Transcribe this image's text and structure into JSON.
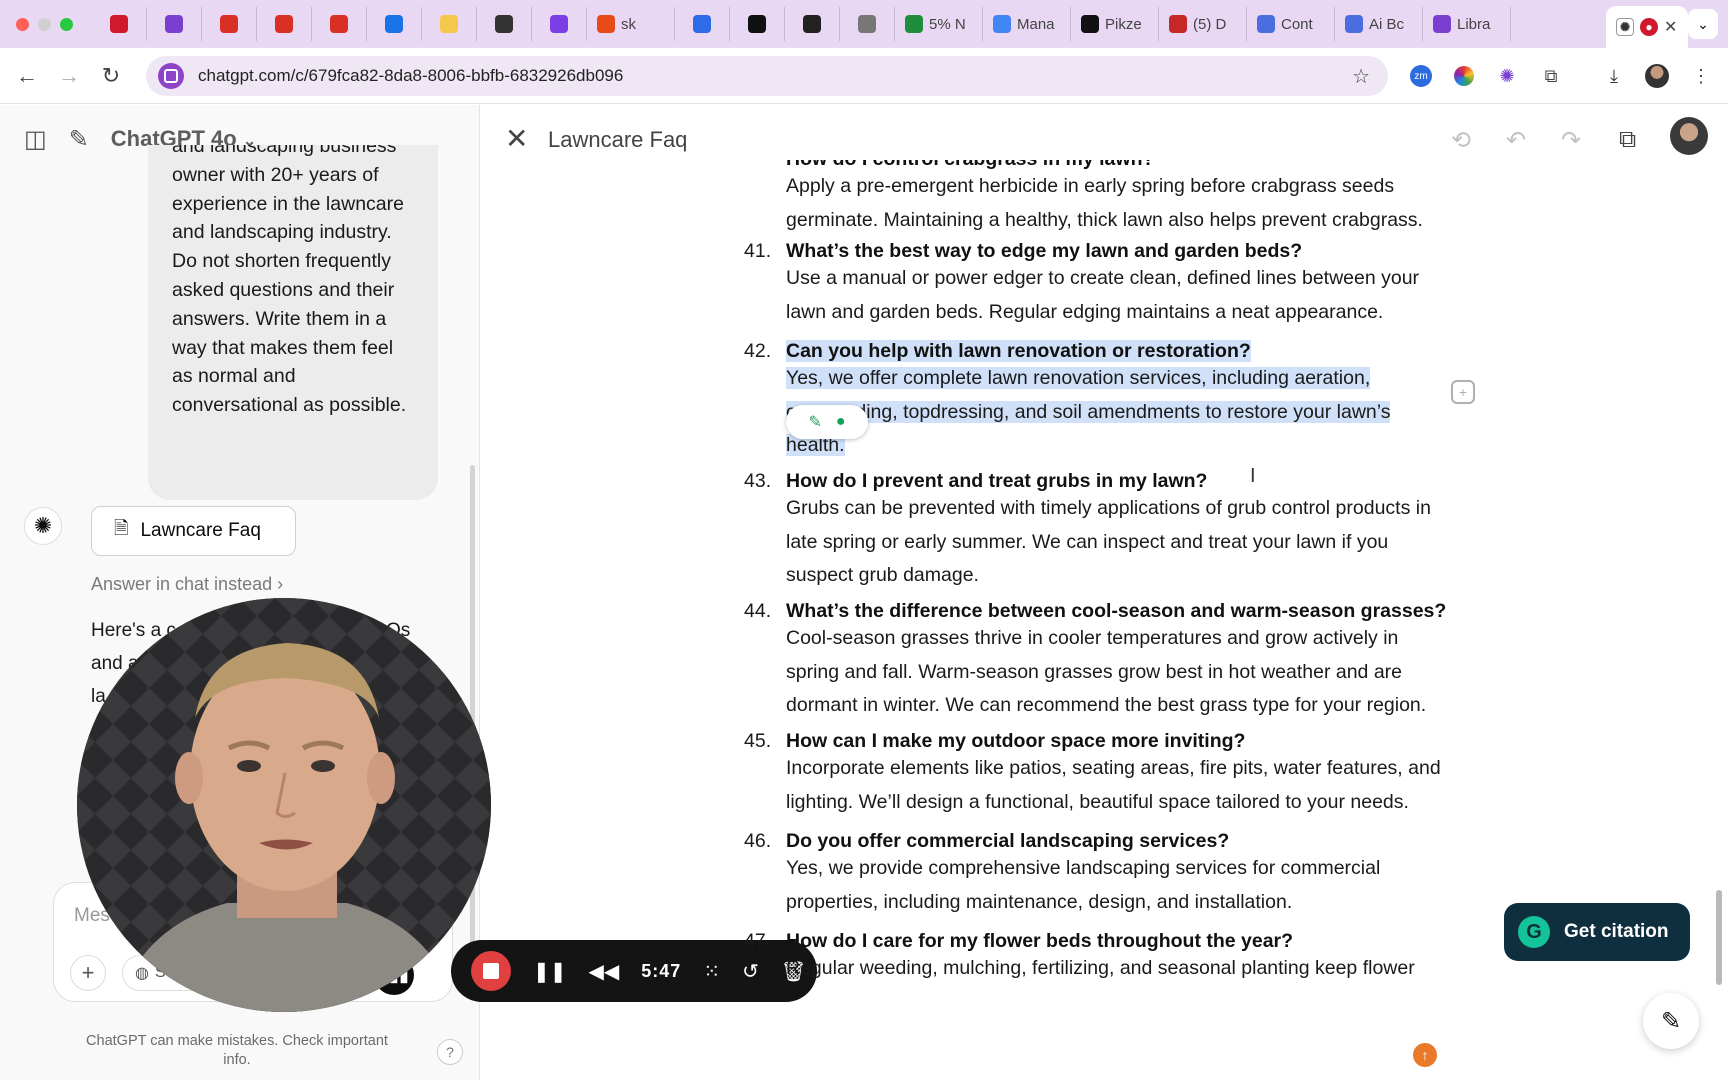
{
  "browser": {
    "tabs": [
      {
        "label": "",
        "icon": "recording-icon",
        "color": "#d0192c"
      },
      {
        "label": "",
        "icon": "asterisk-icon",
        "color": "#7a3fd1"
      },
      {
        "label": "",
        "icon": "gmail-icon",
        "color": "#d93025"
      },
      {
        "label": "",
        "icon": "gmail-icon",
        "color": "#d93025"
      },
      {
        "label": "",
        "icon": "gmail-icon",
        "color": "#d93025"
      },
      {
        "label": "",
        "icon": "calendar-icon",
        "color": "#1a73e8"
      },
      {
        "label": "",
        "icon": "trello-icon",
        "color": "#f2c94c"
      },
      {
        "label": "",
        "icon": "book-icon",
        "color": "#333333"
      },
      {
        "label": "",
        "icon": "s-app-icon",
        "color": "#7b3fe4"
      },
      {
        "label": "sk",
        "icon": "sk-icon",
        "color": "#e64a19"
      },
      {
        "label": "",
        "icon": "loop-icon",
        "color": "#2e6be6"
      },
      {
        "label": "",
        "icon": "s-square-icon",
        "color": "#111111"
      },
      {
        "label": "",
        "icon": "threads-icon",
        "color": "#222222"
      },
      {
        "label": "",
        "icon": "folder-icon",
        "color": "#777777"
      },
      {
        "label": "5% N",
        "icon": "sheets-icon",
        "color": "#1e8e3e"
      },
      {
        "label": "Mana",
        "icon": "google-icon",
        "color": "#4285f4"
      },
      {
        "label": "Pikze",
        "icon": "pikzels-icon",
        "color": "#111111"
      },
      {
        "label": "(5) D",
        "icon": "notification-icon",
        "color": "#c62828"
      },
      {
        "label": "Cont",
        "icon": "docs-icon",
        "color": "#4a6ee0"
      },
      {
        "label": "Ai Bc",
        "icon": "docs-icon",
        "color": "#4a6ee0"
      },
      {
        "label": "Libra",
        "icon": "asterisk-icon",
        "color": "#7a3fd1"
      }
    ],
    "active_tab_icon": "chatgpt-icon",
    "url": "chatgpt.com/c/679fca82-8da8-8006-bbfb-6832926db096"
  },
  "sidebar": {
    "model_name": "ChatGPT 4o",
    "user_message_lines": [
      "and landscaping business",
      "owner with 20+ years of",
      "experience in the lawncare",
      "and landscaping industry.",
      "Do not shorten frequently",
      "asked questions and their",
      "answers. Write them in a",
      "way that makes them feel",
      "as normal and",
      "conversational as possible."
    ],
    "canvas_card_label": "Lawncare Faq",
    "answer_link": "Answer in chat instead",
    "reply_partial_lines": [
      "Here's a c",
      "and a",
      "la"
    ],
    "reply_partial_right": "Os",
    "composer_placeholder": "Mes",
    "search_label": "Sea",
    "disclaimer": "ChatGPT can make mistakes. Check important info.",
    "help_label": "?"
  },
  "recorder": {
    "time": "5:47"
  },
  "document": {
    "title": "Lawncare Faq",
    "partial_top_question": "How do I control crabgrass in my lawn?",
    "partial_top_answer_lines": [
      "Apply a pre-emergent herbicide in early spring before crabgrass seeds",
      "germinate. Maintaining a healthy, thick lawn also helps prevent crabgrass."
    ],
    "faqs": [
      {
        "number": "41.",
        "question": "What’s the best way to edge my lawn and garden beds?",
        "answer_lines": [
          "Use a manual or power edger to create clean, defined lines between your",
          "lawn and garden beds. Regular edging maintains a neat appearance."
        ]
      },
      {
        "number": "42.",
        "question": "Can you help with lawn renovation or restoration?",
        "answer_lines": [
          "Yes, we offer complete lawn renovation services, including aeration,",
          "overseeding, topdressing, and soil amendments to restore your lawn’s",
          "health."
        ]
      },
      {
        "number": "43.",
        "question": "How do I prevent and treat grubs in my lawn?",
        "answer_lines": [
          "Grubs can be prevented with timely applications of grub control products in",
          "late spring or early summer. We can inspect and treat your lawn if you",
          "suspect grub damage."
        ]
      },
      {
        "number": "44.",
        "question": "What’s the difference between cool-season and warm-season grasses?",
        "answer_lines": [
          "Cool-season grasses thrive in cooler temperatures and grow actively in",
          "spring and fall. Warm-season grasses grow best in hot weather and are",
          "dormant in winter. We can recommend the best grass type for your region."
        ]
      },
      {
        "number": "45.",
        "question": "How can I make my outdoor space more inviting?",
        "answer_lines": [
          "Incorporate elements like patios, seating areas, fire pits, water features, and",
          "lighting. We’ll design a functional, beautiful space tailored to your needs."
        ]
      },
      {
        "number": "46.",
        "question": "Do you offer commercial landscaping services?",
        "answer_lines": [
          "Yes, we provide comprehensive landscaping services for commercial",
          "properties, including maintenance, design, and installation."
        ]
      },
      {
        "number": "47.",
        "question": "How do I care for my flower beds throughout the year?",
        "answer_lines": [
          "Regular weeding, mulching, fertilizing, and seasonal planting keep flower"
        ]
      }
    ],
    "get_citation_label": "Get citation"
  },
  "colors": {
    "selection": "#cfe0f8",
    "tabstrip": "#e9d8f4",
    "citation_bg": "#0f2f3f",
    "record_red": "#e04040"
  }
}
